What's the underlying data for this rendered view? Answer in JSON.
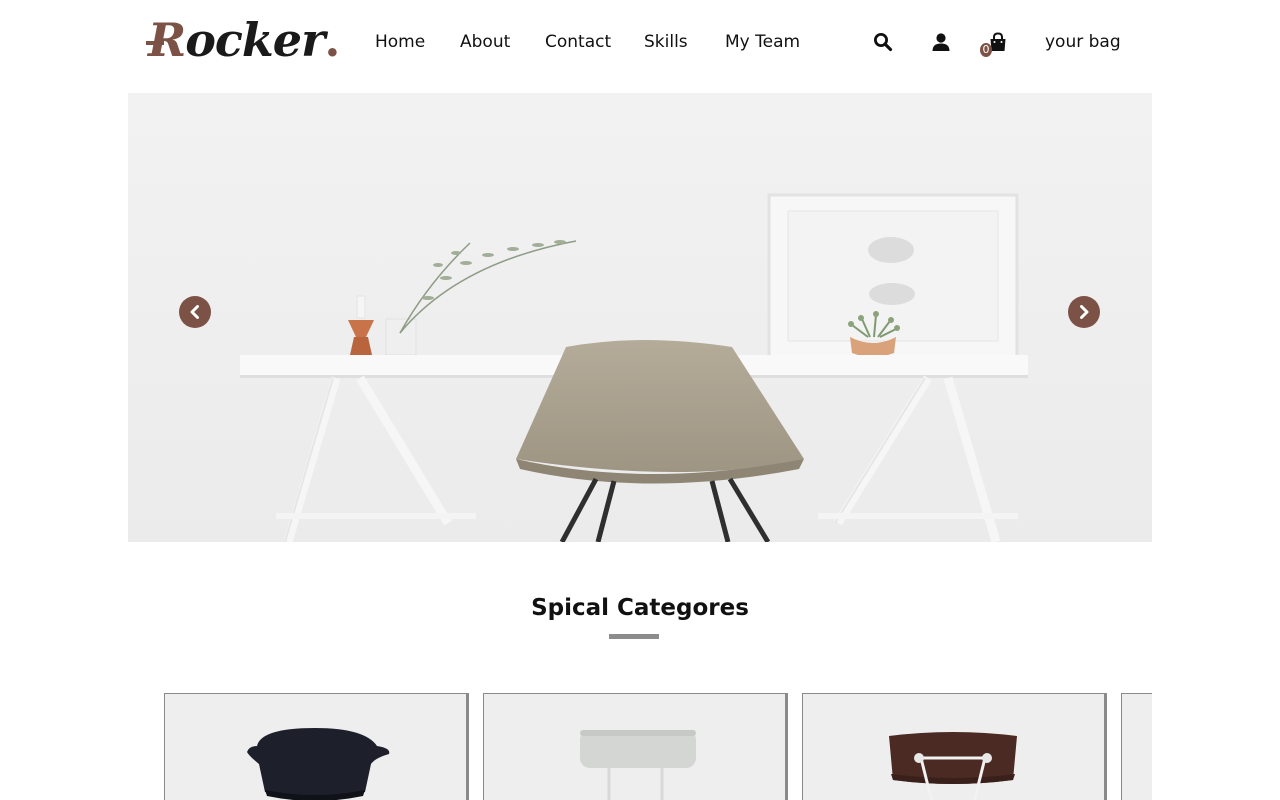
{
  "brand": {
    "logo_first_letter": "R",
    "logo_rest": "ocker",
    "logo_dot": ".",
    "accent_color": "#7d5246"
  },
  "nav": {
    "items": [
      {
        "label": "Home"
      },
      {
        "label": "About"
      },
      {
        "label": "Contact"
      },
      {
        "label": "Skills"
      },
      {
        "label": "My Team"
      }
    ]
  },
  "header_tools": {
    "search_icon": "search-icon",
    "user_icon": "user-icon",
    "bag_icon": "shopping-bag-icon",
    "cart_count": "0",
    "bag_label": "your bag"
  },
  "hero": {
    "prev_icon": "chevron-left-icon",
    "next_icon": "chevron-right-icon"
  },
  "categories": {
    "title": "Spical Categores",
    "cards": [
      {
        "image": "black-shell-chair"
      },
      {
        "image": "white-stool-chair"
      },
      {
        "image": "brown-wood-chair"
      },
      {
        "image": "partial-card"
      }
    ]
  }
}
